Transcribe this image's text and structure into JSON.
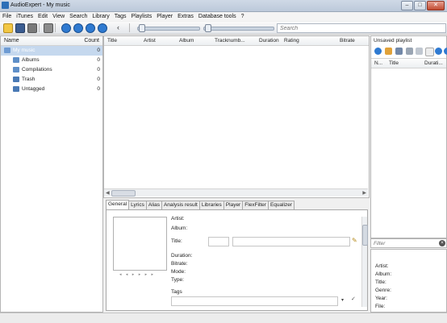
{
  "window": {
    "title": "AudioExpert - My music",
    "controls": [
      "–",
      "□",
      "✕"
    ]
  },
  "menu": [
    "File",
    "iTunes",
    "Edit",
    "View",
    "Search",
    "Library",
    "Tags",
    "Playlists",
    "Player",
    "Extras",
    "Database tools",
    "?"
  ],
  "toolbar": {
    "search_placeholder": "Search",
    "icons": [
      "add-files-icon",
      "save-icon",
      "refresh-icon",
      "undo-icon",
      "play-icon",
      "pause-icon",
      "stop-icon",
      "next-icon",
      "back-icon"
    ]
  },
  "library": {
    "headers": {
      "name": "Name",
      "count": "Count"
    },
    "items": [
      {
        "label": "My music",
        "count": "0",
        "selected": true
      },
      {
        "label": "Albums",
        "count": "0"
      },
      {
        "label": "Compilations",
        "count": "0"
      },
      {
        "label": "Trash",
        "count": "0"
      },
      {
        "label": "Untagged",
        "count": "0"
      }
    ]
  },
  "tracklist": {
    "columns": [
      "Title",
      "Artist",
      "Album",
      "Tracknumb...",
      "Duration",
      "Rating",
      "Bitrate"
    ]
  },
  "info": {
    "tabs": [
      "General",
      "Lyrics",
      "Alias",
      "Analysis result",
      "Libraries",
      "Player",
      "FlexFilter",
      "Equalizer"
    ],
    "labels": {
      "artist": "Artist:",
      "album": "Album:",
      "title": "Title:",
      "duration": "Duration:",
      "bitrate": "Bitrate:",
      "mode": "Mode:",
      "type": "Type:",
      "tags": "Tags"
    }
  },
  "playlist": {
    "title": "Unsaved playlist",
    "columns": [
      "N...",
      "Title",
      "Durati..."
    ],
    "filter_placeholder": "Filter"
  },
  "details": {
    "labels": [
      "Artist:",
      "Album:",
      "Title:",
      "Genre:",
      "Year:",
      "File:"
    ]
  }
}
